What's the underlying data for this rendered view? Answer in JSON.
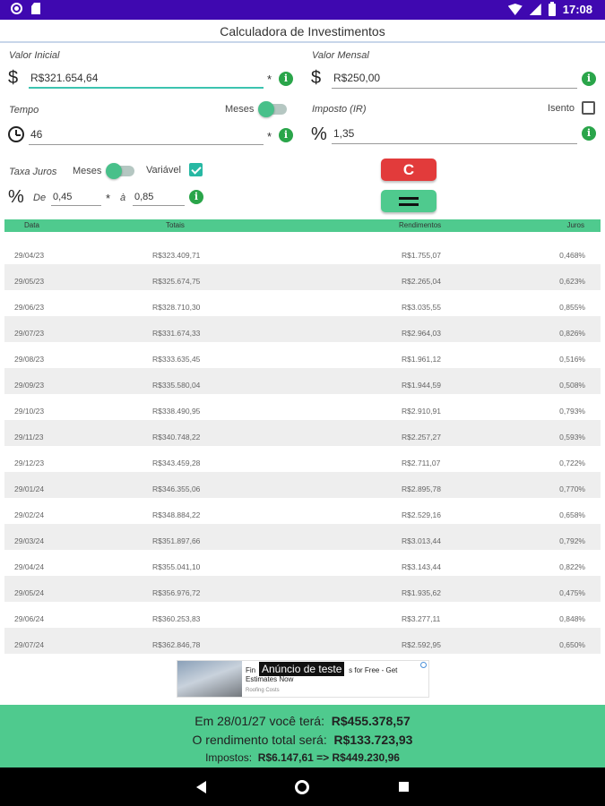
{
  "statusbar": {
    "time": "17:08"
  },
  "app": {
    "title": "Calculadora de Investimentos"
  },
  "form": {
    "valor_inicial": {
      "label": "Valor Inicial",
      "prefix": "$",
      "value": "R$321.654,64",
      "asterisk": "*"
    },
    "valor_mensal": {
      "label": "Valor Mensal",
      "prefix": "$",
      "value": "R$250,00"
    },
    "tempo": {
      "label": "Tempo",
      "toggle_label": "Meses",
      "toggle_on": true,
      "value": "46",
      "asterisk": "*"
    },
    "imposto": {
      "label": "Imposto (IR)",
      "checkbox_label": "Isento",
      "checked": false,
      "prefix": "%",
      "value": "1,35"
    },
    "taxa_juros": {
      "label": "Taxa Juros",
      "toggle_label": "Meses",
      "toggle_on": true,
      "variavel_label": "Variável",
      "variavel_checked": true,
      "prefix": "%",
      "de_label": "De",
      "de_value": "0,45",
      "asterisk": "*",
      "a_label": "à",
      "a_value": "0,85"
    },
    "info_glyph": "i",
    "clear_label": "C"
  },
  "table": {
    "headers": [
      "Data",
      "Totais",
      "Rendimentos",
      "Juros"
    ],
    "rows": [
      [
        "29/04/23",
        "R$323.409,71",
        "R$1.755,07",
        "0,468%"
      ],
      [
        "29/05/23",
        "R$325.674,75",
        "R$2.265,04",
        "0,623%"
      ],
      [
        "29/06/23",
        "R$328.710,30",
        "R$3.035,55",
        "0,855%"
      ],
      [
        "29/07/23",
        "R$331.674,33",
        "R$2.964,03",
        "0,826%"
      ],
      [
        "29/08/23",
        "R$333.635,45",
        "R$1.961,12",
        "0,516%"
      ],
      [
        "29/09/23",
        "R$335.580,04",
        "R$1.944,59",
        "0,508%"
      ],
      [
        "29/10/23",
        "R$338.490,95",
        "R$2.910,91",
        "0,793%"
      ],
      [
        "29/11/23",
        "R$340.748,22",
        "R$2.257,27",
        "0,593%"
      ],
      [
        "29/12/23",
        "R$343.459,28",
        "R$2.711,07",
        "0,722%"
      ],
      [
        "29/01/24",
        "R$346.355,06",
        "R$2.895,78",
        "0,770%"
      ],
      [
        "29/02/24",
        "R$348.884,22",
        "R$2.529,16",
        "0,658%"
      ],
      [
        "29/03/24",
        "R$351.897,66",
        "R$3.013,44",
        "0,792%"
      ],
      [
        "29/04/24",
        "R$355.041,10",
        "R$3.143,44",
        "0,822%"
      ],
      [
        "29/05/24",
        "R$356.976,72",
        "R$1.935,62",
        "0,475%"
      ],
      [
        "29/06/24",
        "R$360.253,83",
        "R$3.277,11",
        "0,848%"
      ],
      [
        "29/07/24",
        "R$362.846,78",
        "R$2.592,95",
        "0,650%"
      ]
    ]
  },
  "ad": {
    "label": "Anúncio de teste",
    "text_left": "Fin",
    "text_right": "s for Free - Get",
    "text_line2": "Estimates Now",
    "sub": "Roofing Costs"
  },
  "summary": {
    "line1_prefix": "Em 28/01/27 você terá:",
    "line1_value": "R$455.378,57",
    "line2_prefix": "O rendimento total será:",
    "line2_value": "R$133.723,93",
    "line3_prefix": "Impostos:",
    "line3_value": "R$6.147,61 => R$449.230,96"
  }
}
